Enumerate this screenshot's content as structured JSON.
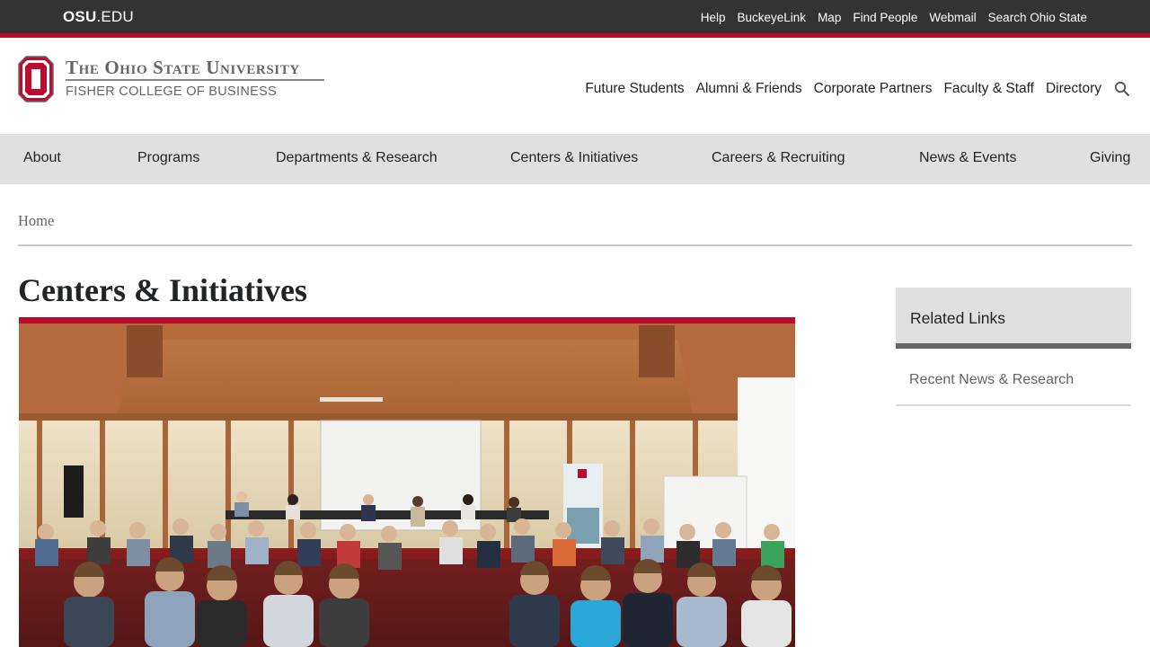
{
  "topbar": {
    "osu_bold": "OSU",
    "osu_rest": ".EDU",
    "links": [
      "Help",
      "BuckeyeLink",
      "Map",
      "Find People",
      "Webmail",
      "Search Ohio State"
    ]
  },
  "logo": {
    "line1": "The Ohio State University",
    "line2": "FISHER COLLEGE OF BUSINESS"
  },
  "audience_nav": [
    "Future Students",
    "Alumni & Friends",
    "Corporate Partners",
    "Faculty & Staff",
    "Directory"
  ],
  "main_nav": [
    "About",
    "Programs",
    "Departments & Research",
    "Centers & Initiatives",
    "Careers & Recruiting",
    "News & Events",
    "Giving"
  ],
  "breadcrumb": {
    "home": "Home"
  },
  "page": {
    "title": "Centers & Initiatives"
  },
  "sidebar": {
    "heading": "Related Links",
    "links": [
      "Recent News & Research"
    ]
  },
  "colors": {
    "scarlet": "#ba0c2f",
    "topbar": "#333333",
    "nav_bg": "#e0e0e0",
    "text": "#212325",
    "muted": "#646464"
  },
  "icons": {
    "search": "search-icon",
    "block_o": "block-o-logo"
  }
}
